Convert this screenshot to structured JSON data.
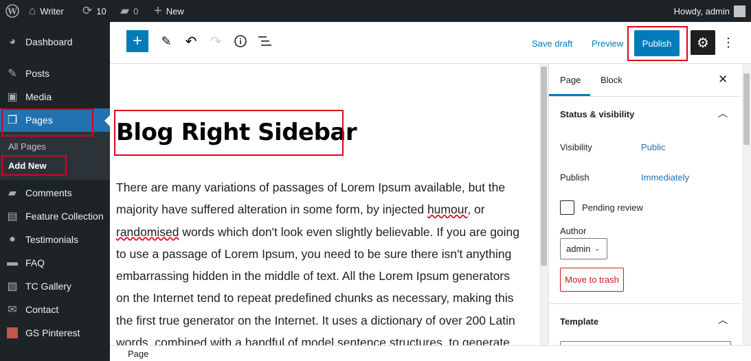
{
  "adminbar": {
    "site": "Writer",
    "updates": "10",
    "comments": "0",
    "new": "New",
    "howdy": "Howdy, admin"
  },
  "sidebar": {
    "items": [
      {
        "label": "Dashboard",
        "icon": "dashboard-icon"
      },
      {
        "label": "Posts",
        "icon": "pin-icon"
      },
      {
        "label": "Media",
        "icon": "media-icon"
      },
      {
        "label": "Pages",
        "icon": "pages-icon"
      },
      {
        "label": "Comments",
        "icon": "comment-icon"
      },
      {
        "label": "Feature Collection",
        "icon": "feature-icon"
      },
      {
        "label": "Testimonials",
        "icon": "user-icon"
      },
      {
        "label": "FAQ",
        "icon": "folder-icon"
      },
      {
        "label": "TC Gallery",
        "icon": "gallery-icon"
      },
      {
        "label": "Contact",
        "icon": "mail-icon"
      },
      {
        "label": "GS Pinterest",
        "icon": "pinterest-icon"
      }
    ],
    "submenu": [
      "All Pages",
      "Add New"
    ]
  },
  "toolbar": {
    "save_draft": "Save draft",
    "preview": "Preview",
    "publish": "Publish"
  },
  "editor": {
    "title": "Blog Right Sidebar",
    "lines": [
      "There are many variations of passages of Lorem Ipsum available, but the",
      "majority have suffered alteration in some form, by injected |humour|, or",
      "|randomised| words which don't look even slightly believable. If you are going",
      "to use a passage of Lorem Ipsum, you need to be sure there isn't anything",
      "embarrassing hidden in the middle of text. All the Lorem Ipsum generators",
      "on the Internet tend to repeat predefined chunks as necessary, making this",
      "the first true generator on the Internet. It uses a dictionary of over 200 Latin",
      "words, combined with a handful of model sentence structures, to generate"
    ]
  },
  "panel": {
    "tabs": [
      "Page",
      "Block"
    ],
    "status_title": "Status & visibility",
    "visibility_label": "Visibility",
    "visibility_value": "Public",
    "publish_label": "Publish",
    "publish_value": "Immediately",
    "pending": "Pending review",
    "author_label": "Author",
    "author_value": "admin",
    "trash": "Move to trash",
    "template_title": "Template"
  },
  "footer": {
    "breadcrumb": "Page"
  },
  "colors": {
    "accent": "#007cba",
    "admin_bg": "#1d2327",
    "annotation": "#e0001a",
    "danger": "#cc1818"
  }
}
